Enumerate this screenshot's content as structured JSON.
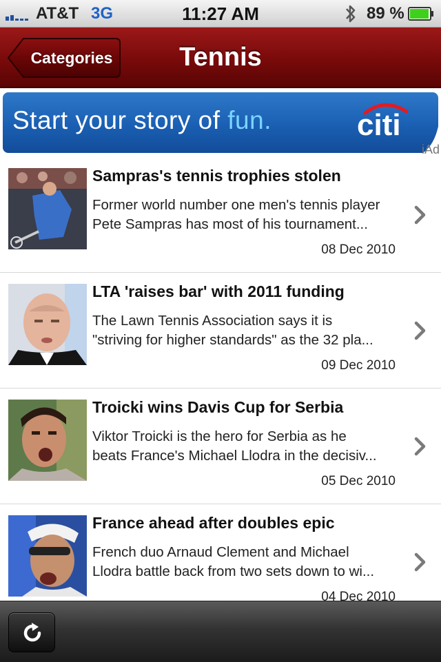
{
  "status_bar": {
    "carrier": "AT&T",
    "network": "3G",
    "time": "11:27 AM",
    "battery_percent": "89 %",
    "icons": [
      "signal-bars-icon",
      "bluetooth-icon",
      "battery-icon"
    ]
  },
  "nav": {
    "back_label": "Categories",
    "title": "Tennis"
  },
  "ad": {
    "text_main": "Start your story of ",
    "text_highlight": "fun.",
    "brand": "citi",
    "label": "iAd"
  },
  "articles": [
    {
      "title": "Sampras's tennis trophies stolen",
      "summary_line1": "Former world number one men's tennis player",
      "summary_line2": "Pete Sampras has most of his tournament...",
      "date": "08 Dec 2010"
    },
    {
      "title": "LTA 'raises bar' with 2011 funding",
      "summary_line1": "The Lawn Tennis Association says it is",
      "summary_line2": "\"striving for higher standards\" as the 32 pla...",
      "date": "09 Dec 2010"
    },
    {
      "title": "Troicki wins Davis Cup for Serbia",
      "summary_line1": "Viktor Troicki is the hero for Serbia as he",
      "summary_line2": "beats France's Michael Llodra in the decisiv...",
      "date": "05 Dec 2010"
    },
    {
      "title": "France ahead after doubles epic",
      "summary_line1": "French duo Arnaud Clement and Michael",
      "summary_line2": "Llodra battle back from two sets down to wi...",
      "date": "04 Dec 2010"
    }
  ],
  "toolbar": {
    "refresh_icon": "refresh-icon"
  },
  "colors": {
    "nav_bar": "#7c0b0b",
    "ad_blue": "#1a5fb3",
    "network": "#1f62c6",
    "battery_green": "#3fd01c"
  }
}
